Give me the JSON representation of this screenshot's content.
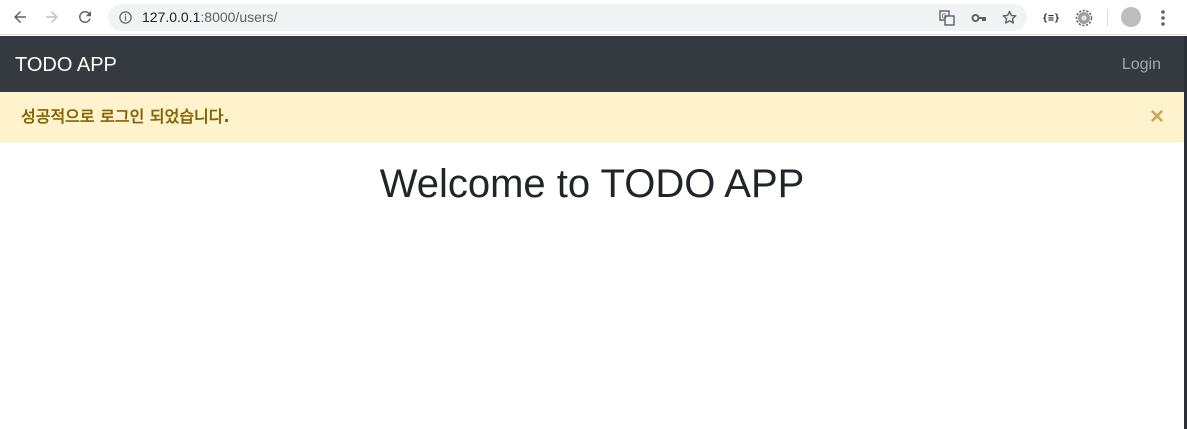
{
  "browser": {
    "url_host": "127.0.0.1",
    "url_rest": ":8000/users/",
    "extension_label": "{≡}"
  },
  "navbar": {
    "brand": "TODO APP",
    "login_label": "Login",
    "background": "#343a40"
  },
  "alert": {
    "message": "성공적으로 로그인 되었습니다.",
    "close_symbol": "×",
    "background": "#fff3cd",
    "text_color": "#856404"
  },
  "main": {
    "heading": "Welcome to TODO APP"
  }
}
